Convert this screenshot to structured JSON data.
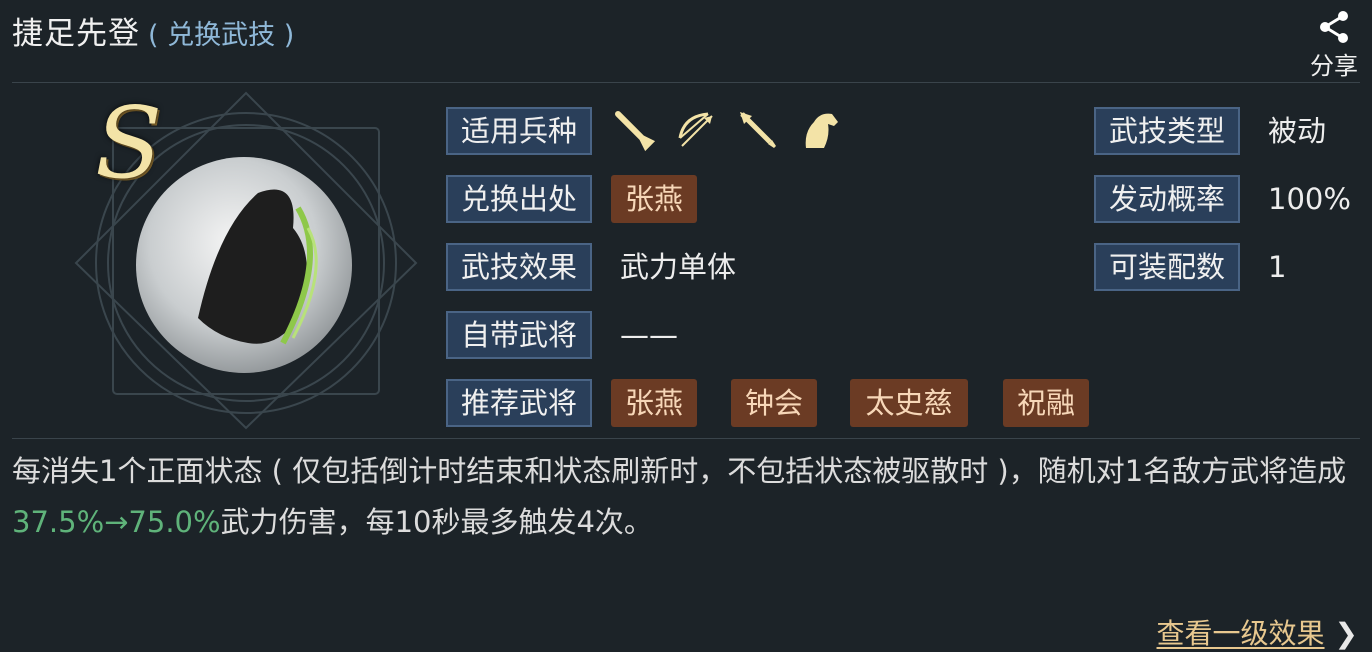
{
  "header": {
    "title": "捷足先登",
    "subtitle": "( 兑换武技 )",
    "share_label": "分享"
  },
  "skill": {
    "grade": "S",
    "troop_types_label": "适用兵种",
    "troop_icons": [
      "sword-icon",
      "bow-icon",
      "spear-icon",
      "horse-icon"
    ],
    "source_label": "兑换出处",
    "source_tag": "张燕",
    "effect_label": "武技效果",
    "effect_value": "武力单体",
    "own_general_label": "自带武将",
    "own_general_value": "——",
    "recommend_label": "推荐武将",
    "recommend_tags": [
      "张燕",
      "钟会",
      "太史慈",
      "祝融"
    ],
    "type_label": "武技类型",
    "type_value": "被动",
    "chance_label": "发动概率",
    "chance_value": "100%",
    "slots_label": "可装配数",
    "slots_value": "1"
  },
  "description": {
    "part1": "每消失1个正面状态 ( 仅包括倒计时结束和状态刷新时，不包括状态被驱散时 )，随机对1名敌方武将造成",
    "highlight": "37.5%→75.0%",
    "part2": "武力伤害，每10秒最多触发4次。"
  },
  "footer": {
    "more_label": "查看一级效果",
    "chevron": "❯"
  },
  "colors": {
    "background": "#1c2328",
    "label_bg": "#2a3f5a",
    "tag_bg": "#6b3b24",
    "highlight": "#5fb37a",
    "link": "#e8c88f"
  }
}
